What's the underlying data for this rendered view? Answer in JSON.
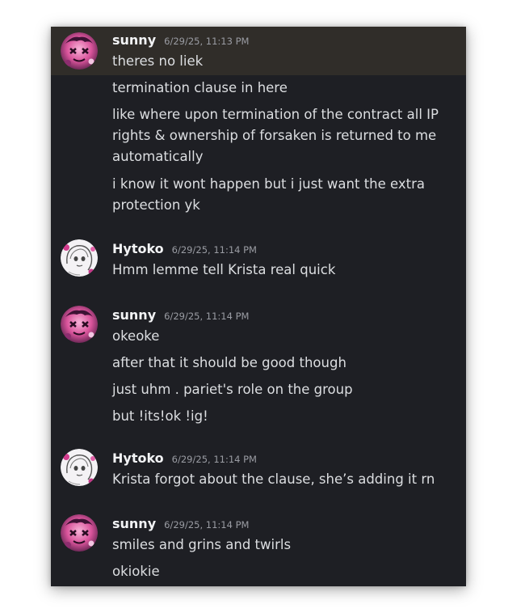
{
  "messages": [
    {
      "username": "sunny",
      "timestamp": "6/29/25, 11:13 PM",
      "avatar": "pink-anime-avatar",
      "lines": [
        "theres no liek",
        "termination clause in here",
        "like where upon termination of the contract all IP rights & ownership of forsaken is returned to me automatically",
        "i know it wont happen but i just want the extra protection yk"
      ]
    },
    {
      "username": "Hytoko",
      "timestamp": "6/29/25, 11:14 PM",
      "avatar": "sketch-anime-avatar",
      "lines": [
        "Hmm lemme tell Krista real quick"
      ]
    },
    {
      "username": "sunny",
      "timestamp": "6/29/25, 11:14 PM",
      "avatar": "pink-anime-avatar",
      "lines": [
        "okeoke",
        "after that it should be good though",
        "just uhm . pariet's role on the group",
        "but !its!ok !ig!"
      ]
    },
    {
      "username": "Hytoko",
      "timestamp": "6/29/25, 11:14 PM",
      "avatar": "sketch-anime-avatar",
      "lines": [
        "Krista forgot about the clause, she’s adding it rn"
      ]
    },
    {
      "username": "sunny",
      "timestamp": "6/29/25, 11:14 PM",
      "avatar": "pink-anime-avatar",
      "lines": [
        "smiles and grins and twirls",
        "okiokie"
      ]
    }
  ],
  "colors": {
    "panel_background": "#1e1f24",
    "highlight_background": "#302d29",
    "username": "#f2f3f5",
    "timestamp": "#9a9ca3",
    "message_text": "#dcdee1"
  }
}
